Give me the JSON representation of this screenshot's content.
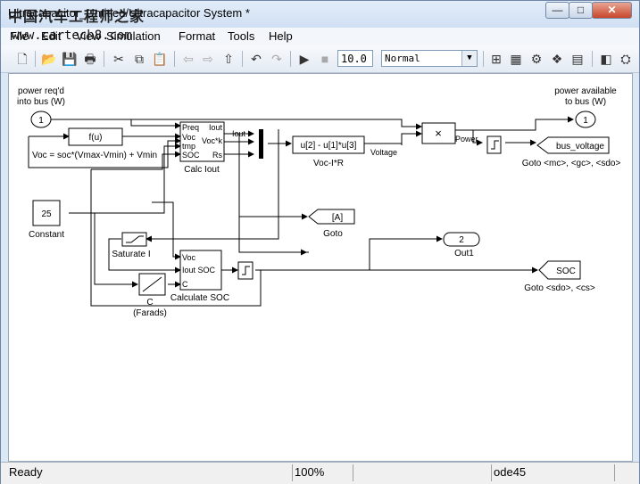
{
  "window": {
    "title": "Ultracapacitor_Untitled/Ultracapacitor  System *",
    "watermark_cn": "中国汽车工程师之家",
    "watermark_url": "www.cartech8.com",
    "min_glyph": "—",
    "max_glyph": "□",
    "close_glyph": "✕"
  },
  "menu": [
    "File",
    "Edit",
    "View",
    "Simulation",
    "Format",
    "Tools",
    "Help"
  ],
  "toolbar": {
    "icons": [
      "new-icon",
      "open-icon",
      "save-icon",
      "print-icon",
      "cut-icon",
      "copy-icon",
      "paste-icon",
      "back-icon",
      "forward-icon",
      "up-icon",
      "undo-icon",
      "redo-icon",
      "play-icon",
      "stop-icon",
      "model-explorer-icon",
      "library-icon",
      "debugger-icon",
      "config-icon",
      "build-icon",
      "target-icon",
      "help-icon"
    ],
    "glyphs": {
      "new": "🗋",
      "open": "📂",
      "save": "💾",
      "print": "🖶",
      "cut": "✂",
      "copy": "⧉",
      "paste": "📋",
      "back": "⇦",
      "forward": "⇨",
      "up": "⇧",
      "undo": "↶",
      "redo": "↷",
      "play": "▶",
      "stop": "■",
      "t1": "⊞",
      "t2": "▦",
      "t3": "⚙",
      "t4": "❖",
      "t5": "▤",
      "t6": "◧",
      "t7": "⛭"
    },
    "stop_time": "10.0",
    "sim_mode": "Normal"
  },
  "diagram": {
    "in1_label": "power req'd\ninto bus (W)",
    "in1_num": "1",
    "out1_label": "power available\nto bus (W)",
    "out1_num": "1",
    "fcn": "f(u)",
    "voc_label": "Voc = soc*(Vmax-Vmin) + Vmin",
    "calc_iout_ports_in": [
      "Preq",
      "Voc",
      "tmp",
      "SOC"
    ],
    "calc_iout_ports_out": [
      "Iout",
      "Voc*k",
      "Rs"
    ],
    "calc_iout_name": "Calc Iout",
    "iout_signal": "Iout",
    "voc_ir_expr": "u[2] - u[1]*u[3]",
    "voc_ir_name": "Voc-I*R",
    "voltage_signal": "Voltage",
    "product": "×",
    "power_signal": "Power",
    "from_bus": "bus_voltage",
    "goto_mc_label": "Goto <mc>, <gc>, <sdo>",
    "constant_value": "25",
    "constant_name": "Constant",
    "goto_a": "[A]",
    "goto_name": "Goto",
    "saturate_name": "Saturate I",
    "calc_soc_ports_in": [
      "Voc",
      "Iout SOC",
      "C"
    ],
    "calc_soc_name": "Calculate SOC",
    "gain_label": "C\n(Farads)",
    "out2_num": "2",
    "out2_name": "Out1",
    "soc_tag": "SOC",
    "goto_soc_label": "Goto <sdo>, <cs>"
  },
  "status": {
    "ready": "Ready",
    "zoom": "100%",
    "solver": "ode45"
  }
}
